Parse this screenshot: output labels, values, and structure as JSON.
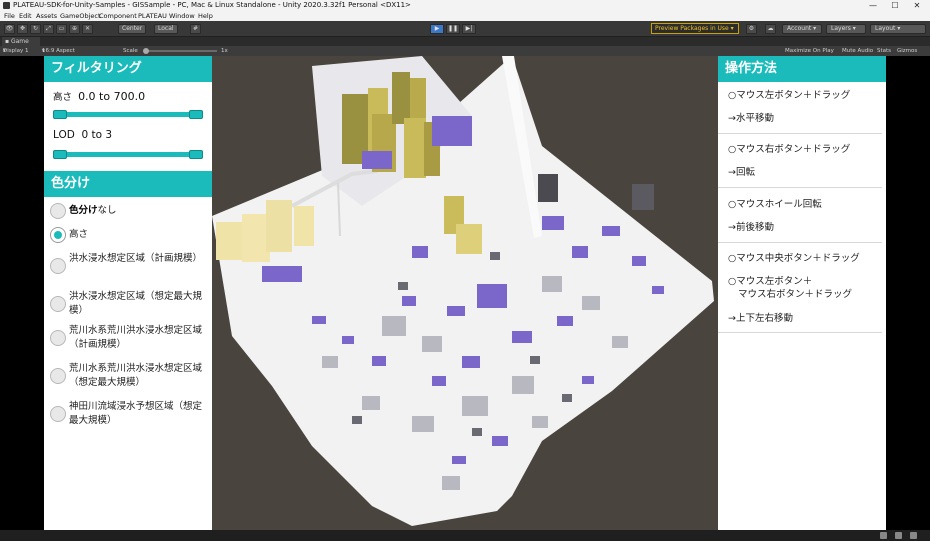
{
  "window": {
    "title": "PLATEAU-SDK-for-Unity-Samples - GISSample - PC, Mac & Linux Standalone - Unity 2020.3.32f1 Personal <DX11>",
    "controls": [
      "—",
      "☐",
      "✕"
    ]
  },
  "menu": [
    "File",
    "Edit",
    "Assets",
    "GameObject",
    "Component",
    "PLATEAU",
    "Window",
    "Help"
  ],
  "toolbar": {
    "center_label": "Center",
    "local_label": "Local",
    "preview_packages": "Preview Packages in Use",
    "account": "Account",
    "layers": "Layers",
    "layout": "Layout"
  },
  "game": {
    "tab_label": "Game",
    "display": "Display 1",
    "aspect": "16:9 Aspect",
    "scale_label": "Scale",
    "scale_value": "1x",
    "maximize": "Maximize On Play",
    "mute": "Mute Audio",
    "stats": "Stats",
    "gizmos": "Gizmos"
  },
  "filter": {
    "title": "フィルタリング",
    "height_label": "高さ",
    "height_range": "0.0 to 700.0",
    "height_min": 0,
    "height_max": 1,
    "lod_label": "LOD",
    "lod_range": "0 to 3",
    "lod_min": 0,
    "lod_max": 1
  },
  "coloring": {
    "title": "色分け",
    "options": [
      {
        "bold": "色分け",
        "rest": "なし",
        "selected": false
      },
      {
        "bold": "",
        "rest": "高さ",
        "selected": true
      },
      {
        "bold": "",
        "rest": "洪水浸水想定区域（計画規模）",
        "selected": false
      },
      {
        "bold": "",
        "rest": "洪水浸水想定区域（想定最大規模）",
        "selected": false
      },
      {
        "bold": "",
        "rest": "荒川水系荒川洪水浸水想定区域（計画規模）",
        "selected": false
      },
      {
        "bold": "",
        "rest": "荒川水系荒川洪水浸水想定区域（想定最大規模）",
        "selected": false
      },
      {
        "bold": "",
        "rest": "神田川流域浸水予想区域（想定最大規模）",
        "selected": false
      }
    ]
  },
  "controls_help": {
    "title": "操作方法",
    "items": [
      {
        "input": "マウス左ボタン＋ドラッグ",
        "action": "水平移動"
      },
      {
        "input": "マウス右ボタン＋ドラッグ",
        "action": "回転"
      },
      {
        "input": "マウスホイール回転",
        "action": "前後移動"
      },
      {
        "input": "マウス中央ボタン＋ドラッグ",
        "input2": "マウス左ボタン＋",
        "input3": "マウス右ボタン＋ドラッグ",
        "action": "上下左右移動"
      }
    ]
  },
  "colors": {
    "accent": "#1cbbbb",
    "panel_bg": "#ffffff",
    "scene_bg": "#4a443f",
    "building_purple": "#7b66c9",
    "building_tall": "#bfb060"
  }
}
